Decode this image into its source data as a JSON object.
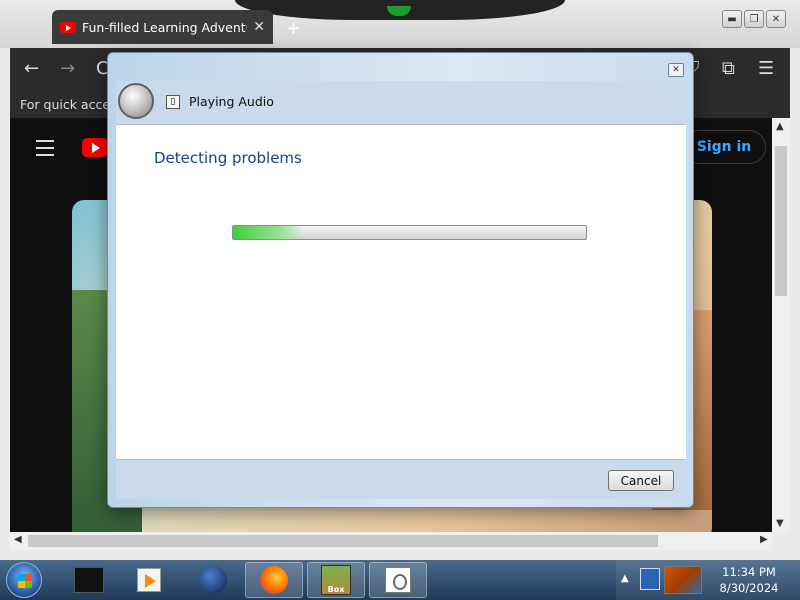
{
  "browser": {
    "tab_title": "Fun-filled Learning Adventure",
    "tab_close": "✕",
    "new_tab": "+",
    "window_buttons": [
      "▬",
      "❐",
      "✕"
    ],
    "bookmarks_text": "For quick access,",
    "nav": {
      "back": "←",
      "forward": "→",
      "reload": "C",
      "extensions": "⧉",
      "menu": "☰"
    }
  },
  "page": {
    "sign_in": "Sign in"
  },
  "dialog": {
    "header_title": "Playing Audio",
    "heading": "Detecting problems",
    "progress_fraction": 0.2,
    "cancel_label": "Cancel",
    "close_glyph": "✕"
  },
  "taskbar": {
    "game_label": "Box",
    "clock_time": "11:34 PM",
    "clock_date": "8/30/2024",
    "tray_arrow": "▲"
  },
  "scroll": {
    "up": "▲",
    "down": "▼",
    "left": "◀",
    "right": "▶"
  }
}
